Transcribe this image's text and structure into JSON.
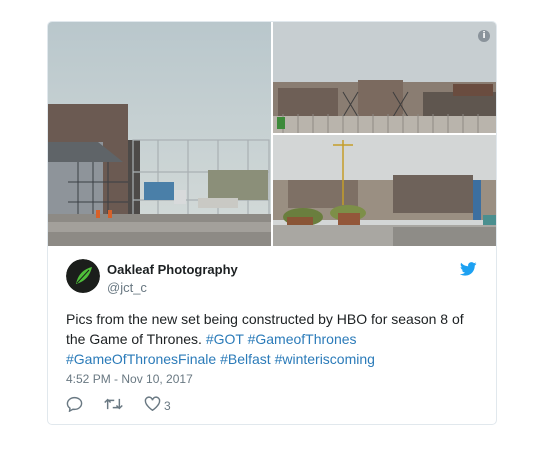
{
  "tweet": {
    "media": [
      {
        "alt": "construction site photo 1"
      },
      {
        "alt": "construction site photo 2"
      },
      {
        "alt": "construction site photo 3"
      }
    ],
    "author": {
      "display_name": "Oakleaf Photography",
      "handle": "@jct_c",
      "avatar_icon": "oakleaf-avatar"
    },
    "text": {
      "line1": "Pics from the new set being constructed by HBO for season 8 of",
      "line2_prefix": "the Game of Thrones.",
      "hashtags": [
        "#GOT",
        "#GameofThrones",
        "#GameOfThronesFinale",
        "#Belfast",
        "#winteriscoming"
      ]
    },
    "timestamp": "4:52 PM - Nov 10, 2017",
    "actions": {
      "like_count": "3"
    },
    "colors": {
      "link": "#2b7bb9",
      "twitter_blue": "#1da1f2",
      "meta": "#697882",
      "border": "#e1e8ed"
    }
  }
}
